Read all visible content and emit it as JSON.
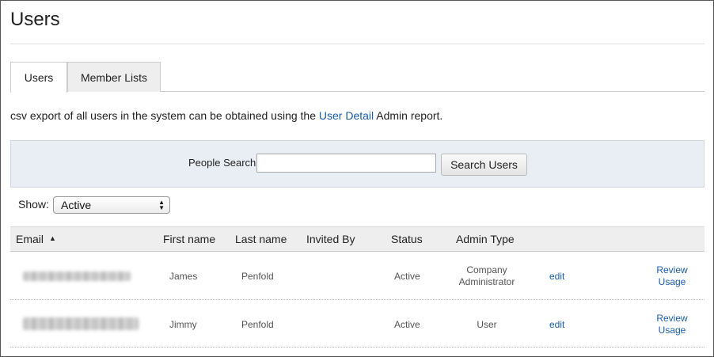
{
  "page": {
    "title": "Users"
  },
  "tabs": [
    {
      "label": "Users",
      "active": true
    },
    {
      "label": "Member Lists",
      "active": false
    }
  ],
  "intro": {
    "text_before": "csv export of all users in the system can be obtained using the ",
    "link": "User Detail",
    "text_after": " Admin report."
  },
  "search": {
    "label": "People Search",
    "value": "",
    "placeholder": "",
    "button": "Search Users"
  },
  "filter": {
    "label": "Show:",
    "selected": "Active"
  },
  "table": {
    "headers": {
      "email": "Email",
      "first_name": "First name",
      "last_name": "Last name",
      "invited_by": "Invited By",
      "status": "Status",
      "admin_type": "Admin Type"
    },
    "sort_column": "email",
    "rows": [
      {
        "first_name": "James",
        "last_name": "Penfold",
        "invited_by": "",
        "status": "Active",
        "admin_type_line1": "Company",
        "admin_type_line2": "Administrator",
        "edit": "edit",
        "review_line1": "Review",
        "review_line2": "Usage"
      },
      {
        "first_name": "Jimmy",
        "last_name": "Penfold",
        "invited_by": "",
        "status": "Active",
        "admin_type_line1": "User",
        "admin_type_line2": "",
        "edit": "edit",
        "review_line1": "Review",
        "review_line2": "Usage"
      }
    ]
  },
  "colors": {
    "link": "#1a5ea8",
    "search_panel_bg": "#e9eef4",
    "header_bg": "#eeeeee"
  }
}
